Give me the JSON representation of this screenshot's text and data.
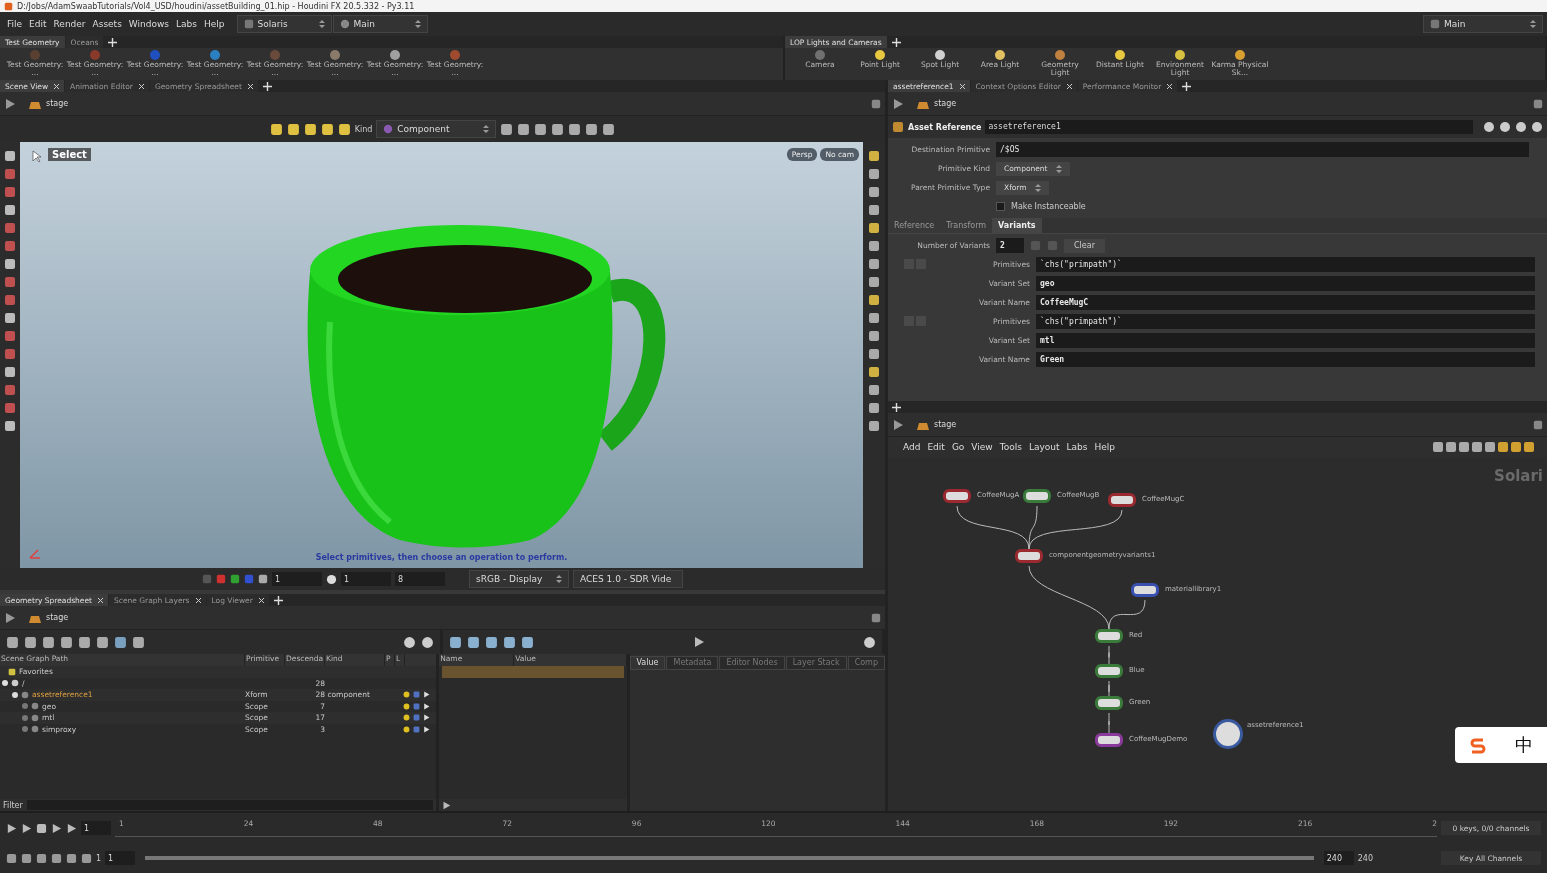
{
  "window": {
    "title": "D:/Jobs/AdamSwaabTutorials/Vol4_USD/houdini/assetBuilding_01.hip - Houdini FX 20.5.332 - Py3.11"
  },
  "menu": [
    "File",
    "Edit",
    "Render",
    "Assets",
    "Windows",
    "Labs",
    "Help"
  ],
  "desktop": {
    "label": "Solaris"
  },
  "layout": {
    "label": "Main"
  },
  "right_layout": {
    "label": "Main"
  },
  "shelf_left": {
    "tabs": [
      {
        "label": "Test Geometry",
        "selected": true
      },
      {
        "label": "Oceans",
        "selected": false
      }
    ],
    "tools": [
      {
        "label": "Test Geometry: ...",
        "color": "#5a4030"
      },
      {
        "label": "Test Geometry: ...",
        "color": "#8a3a2a"
      },
      {
        "label": "Test Geometry: ...",
        "color": "#2050c0"
      },
      {
        "label": "Test Geometry: ...",
        "color": "#2a80c0"
      },
      {
        "label": "Test Geometry: ...",
        "color": "#6a4a3a"
      },
      {
        "label": "Test Geometry: ...",
        "color": "#8a7a6a"
      },
      {
        "label": "Test Geometry: ...",
        "color": "#a0a0a0"
      },
      {
        "label": "Test Geometry: ...",
        "color": "#a04a30"
      }
    ]
  },
  "shelf_right": {
    "tabs": [
      {
        "label": "LOP Lights and Cameras",
        "selected": true
      }
    ],
    "tools": [
      {
        "label": "Camera",
        "color": "#707070"
      },
      {
        "label": "Point Light",
        "color": "#e8c840"
      },
      {
        "label": "Spot Light",
        "color": "#d0d0d0"
      },
      {
        "label": "Area Light",
        "color": "#e0c060"
      },
      {
        "label": "Geometry Light",
        "color": "#c08040"
      },
      {
        "label": "Distant Light",
        "color": "#e8c840"
      },
      {
        "label": "Environment Light",
        "color": "#d8c040"
      },
      {
        "label": "Karma Physical Sk...",
        "color": "#d8a030"
      }
    ]
  },
  "scene_view": {
    "tabs": [
      {
        "label": "Scene View",
        "selected": true
      },
      {
        "label": "Animation Editor",
        "selected": false
      },
      {
        "label": "Geometry Spreadsheet",
        "selected": false
      }
    ],
    "path": "stage",
    "kind_label": "Kind",
    "kind_value": "Component",
    "tool_label": "Select",
    "camera_buttons": [
      "Persp",
      "No cam"
    ],
    "message": "Select primitives, then choose an operation to perform.",
    "fields": [
      "1",
      "1",
      "8"
    ],
    "display": "sRGB - Display",
    "view": "ACES 1.0 - SDR Vide"
  },
  "spreadsheet": {
    "tabs": [
      {
        "label": "Geometry Spreadsheet",
        "selected": true
      },
      {
        "label": "Scene Graph Layers",
        "selected": false
      },
      {
        "label": "Log Viewer",
        "selected": false
      }
    ],
    "path": "stage",
    "columns": [
      "Scene Graph Path",
      "Primitive",
      "Descenda",
      "Kind",
      "P",
      "L"
    ],
    "favorites": "Favorites",
    "tree": [
      {
        "name": "/",
        "descendants": "28",
        "expanded": true,
        "children": [
          {
            "name": "assetreference1",
            "primitive": "Xform",
            "descendants": "28",
            "prim_kind": "component",
            "highlighted": true,
            "expanded": true,
            "children": [
              {
                "name": "geo",
                "primitive": "Scope",
                "descendants": "7",
                "highlighted": false,
                "expanded": false
              },
              {
                "name": "mtl",
                "primitive": "Scope",
                "descendants": "17",
                "highlighted": false,
                "expanded": false
              },
              {
                "name": "simproxy",
                "primitive": "Scope",
                "descendants": "3",
                "highlighted": false,
                "expanded": false
              }
            ]
          }
        ]
      }
    ],
    "property_columns": [
      "Name",
      "Value"
    ],
    "inspector_tabs": [
      {
        "label": "Value",
        "selected": true
      },
      {
        "label": "Metadata",
        "selected": false
      },
      {
        "label": "Editor Nodes",
        "selected": false
      },
      {
        "label": "Layer Stack",
        "selected": false
      },
      {
        "label": "Comp",
        "selected": false
      }
    ],
    "filter": "Filter"
  },
  "params": {
    "tabs": [
      {
        "label": "assetreference1",
        "selected": true
      },
      {
        "label": "Context Options Editor",
        "selected": false
      },
      {
        "label": "Performance Monitor",
        "selected": false
      }
    ],
    "path": "stage",
    "node_type": "Asset Reference",
    "node_name": "assetreference1",
    "fields": [
      {
        "kind": "text",
        "label": "Destination Primitive",
        "value": "/$OS"
      },
      {
        "kind": "menu",
        "label": "Primitive Kind",
        "value": "Component"
      },
      {
        "kind": "menu",
        "label": "Parent Primitive Type",
        "value": "Xform"
      },
      {
        "kind": "toggle",
        "label": "Make Instanceable",
        "checked": false
      }
    ],
    "folder_tabs": [
      {
        "label": "Reference",
        "selected": false
      },
      {
        "label": "Transform",
        "selected": false
      },
      {
        "label": "Variants",
        "selected": true
      }
    ],
    "count_label": "Number of Variants",
    "count_value": "2",
    "clear": "Clear",
    "variants": [
      {
        "fields": [
          {
            "label": "Primitives",
            "value": "`chs(\"primpath\")`"
          },
          {
            "label": "Variant Set",
            "value": "geo"
          },
          {
            "label": "Variant Name",
            "value": "CoffeeMugC"
          }
        ]
      },
      {
        "fields": [
          {
            "label": "Primitives",
            "value": "`chs(\"primpath\")`"
          },
          {
            "label": "Variant Set",
            "value": "mtl"
          },
          {
            "label": "Variant Name",
            "value": "Green"
          }
        ]
      }
    ]
  },
  "network": {
    "path": "stage",
    "menu": [
      "Add",
      "Edit",
      "Go",
      "View",
      "Tools",
      "Layout",
      "Labs",
      "Help"
    ],
    "context_label": "Solari",
    "nodes": [
      {
        "name": "CoffeeMugA",
        "color": "#9a2a30"
      },
      {
        "name": "CoffeeMugB",
        "color": "#3a7a3a"
      },
      {
        "name": "CoffeeMugC",
        "color": "#9a2a30"
      },
      {
        "name": "componentgeometryvariants1",
        "color": "#9a2a30"
      },
      {
        "name": "materiallibrary1",
        "color": "#3a50b0"
      },
      {
        "name": "Red",
        "color": "#3a7a3a"
      },
      {
        "name": "Blue",
        "color": "#3a7a3a"
      },
      {
        "name": "Green",
        "color": "#3a7a3a"
      },
      {
        "name": "CoffeeMugDemo",
        "color": "#8a3a9a"
      },
      {
        "name": "assetreference1",
        "color": "#3a5aa0"
      }
    ]
  },
  "timeline": {
    "frame": "1",
    "ticks": [
      "1",
      "24",
      "48",
      "72",
      "96",
      "120",
      "144",
      "168",
      "192",
      "216",
      "2"
    ],
    "start": "1",
    "range_start": "1",
    "range_end": "240",
    "end": "240",
    "keys": "0 keys, 0/0 channels",
    "key_all": "Key All Channels",
    "range_bar": {
      "level": 1
    }
  },
  "ime": {
    "label": "中"
  }
}
